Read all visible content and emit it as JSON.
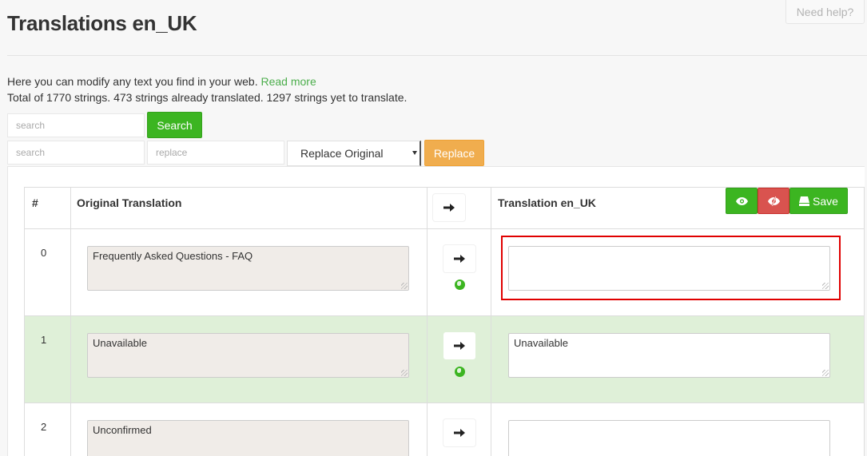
{
  "help": {
    "label": "Need help?"
  },
  "page": {
    "title": "Translations en_UK"
  },
  "intro": {
    "line1": "Here you can modify any text you find in your web.",
    "read_more": "Read more",
    "line2": "Total of 1770 strings. 473 strings already translated. 1297 strings yet to translate."
  },
  "search": {
    "placeholder": "search",
    "button": "Search"
  },
  "replace": {
    "search_placeholder": "search",
    "replace_placeholder": "replace",
    "mode_selected": "Replace Original",
    "button": "Replace"
  },
  "table": {
    "headers": {
      "num": "#",
      "original": "Original Translation",
      "translation": "Translation en_UK"
    },
    "save_label": "Save",
    "rows": [
      {
        "num": "0",
        "original": "Frequently Asked Questions - FAQ",
        "translation": ""
      },
      {
        "num": "1",
        "original": "Unavailable",
        "translation": "Unavailable"
      },
      {
        "num": "2",
        "original": "Unconfirmed",
        "translation": ""
      }
    ]
  },
  "colors": {
    "green": "#3cb521",
    "orange": "#f0ad4e",
    "red": "#d9534f",
    "row_highlight": "#dff0d8"
  },
  "icons": {
    "copy": "arrow-right-icon",
    "auto": "globe-icon",
    "show": "eye-icon",
    "hide": "eye-slash-icon",
    "save": "save-icon"
  }
}
